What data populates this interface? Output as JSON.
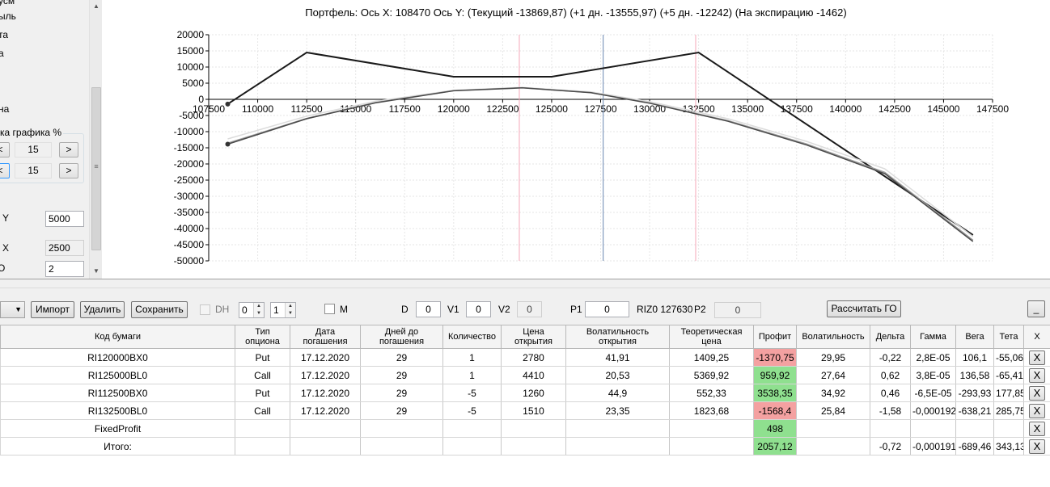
{
  "left_panel": {
    "items": [
      "усм",
      "ыль",
      "та",
      "а",
      "на"
    ],
    "group_label": "ка графика %",
    "row1": {
      "prev": "<",
      "value": "15",
      "next": ">"
    },
    "row2": {
      "prev": "<",
      "value": "15",
      "next": ">"
    },
    "y_label": "Y",
    "y_value": "5000",
    "x_label": "X",
    "x_value": "2500",
    "o_label": "O",
    "o_value": "2",
    "grip": "≡"
  },
  "chart": {
    "title": "Портфель: Ось X: 108470 Ось Y:  (Текущий -13869,87)  (+1 дн. -13555,97)  (+5 дн. -12242)  (На экспирацию -1462)"
  },
  "chart_data": {
    "type": "line",
    "title": "Портфель: Ось X: 108470 Ось Y:  (Текущий -13869,87)  (+1 дн. -13555,97)  (+5 дн. -12242)  (На экспирацию -1462)",
    "xlabel": "",
    "ylabel": "",
    "xlim": [
      107500,
      147500
    ],
    "ylim": [
      -50000,
      20000
    ],
    "x_ticks": [
      "107500",
      "110000",
      "112500",
      "115000",
      "117500",
      "120000",
      "122500",
      "125000",
      "127500",
      "130000",
      "132500",
      "135000",
      "137500",
      "140000",
      "142500",
      "145000",
      "147500"
    ],
    "y_ticks": [
      "20000",
      "15000",
      "10000",
      "5000",
      "0",
      "-5000",
      "-10000",
      "-15000",
      "-20000",
      "-25000",
      "-30000",
      "-35000",
      "-40000",
      "-45000",
      "-50000"
    ],
    "grid": true,
    "vertical_lines": [
      {
        "x": 123350,
        "color": "#f4a8b8"
      },
      {
        "x": 127630,
        "color": "#6a86b0"
      },
      {
        "x": 132350,
        "color": "#f4a8b8"
      }
    ],
    "series": [
      {
        "color": "#1a1a1a",
        "points": [
          [
            108470,
            -1462
          ],
          [
            112500,
            14500
          ],
          [
            120000,
            7000
          ],
          [
            125000,
            7000
          ],
          [
            132500,
            14500
          ],
          [
            146500,
            -42000
          ]
        ]
      },
      {
        "color": "#dcdcdc",
        "points": [
          [
            108470,
            -12242
          ],
          [
            112500,
            -5200
          ],
          [
            116000,
            -600
          ],
          [
            120000,
            2800
          ],
          [
            123500,
            3700
          ],
          [
            127000,
            2300
          ],
          [
            130000,
            -700
          ],
          [
            134000,
            -6000
          ],
          [
            138000,
            -13000
          ],
          [
            142000,
            -21500
          ],
          [
            146500,
            -42500
          ]
        ]
      },
      {
        "color": "#9e9e9e",
        "points": [
          [
            108470,
            -13556
          ],
          [
            112500,
            -5900
          ],
          [
            116000,
            -1000
          ],
          [
            120000,
            2700
          ],
          [
            123500,
            3600
          ],
          [
            127000,
            2100
          ],
          [
            130000,
            -1100
          ],
          [
            134000,
            -6600
          ],
          [
            138000,
            -13800
          ],
          [
            142000,
            -22600
          ],
          [
            146500,
            -43600
          ]
        ]
      },
      {
        "color": "#4a4a4a",
        "points": [
          [
            108470,
            -13870
          ],
          [
            112500,
            -6000
          ],
          [
            116000,
            -1100
          ],
          [
            120000,
            2650
          ],
          [
            123500,
            3550
          ],
          [
            127000,
            2050
          ],
          [
            130000,
            -1200
          ],
          [
            134000,
            -6800
          ],
          [
            138000,
            -14100
          ],
          [
            142000,
            -23000
          ],
          [
            146500,
            -44000
          ]
        ]
      }
    ],
    "markers": [
      [
        108470,
        -1462
      ],
      [
        108470,
        -13870
      ]
    ]
  },
  "toolbar": {
    "dropdown_value": "",
    "import_label": "Импорт",
    "delete_label": "Удалить",
    "save_label": "Сохранить",
    "dh_label": "DH",
    "spin1_value": "0",
    "spin2_value": "1",
    "m_label": "M",
    "d_label": "D",
    "d_value": "0",
    "v1_label": "V1",
    "v1_value": "0",
    "v2_label": "V2",
    "v2_value": "0",
    "p1_label": "P1",
    "p1_value": "0",
    "riz_label": "RIZ0 127630",
    "p2_label": "P2",
    "p2_value": "0",
    "calc_label": "Рассчитать ГО",
    "minimize_label": "_"
  },
  "grid": {
    "columns": [
      "Код бумаги",
      "Тип опциона",
      "Дата погашения",
      "Дней до погашения",
      "Количество",
      "Цена открытия",
      "Волатильность открытия",
      "Теоретическая цена",
      "Профит",
      "Волатильность",
      "Дельта",
      "Гамма",
      "Вега",
      "Тета",
      "X"
    ],
    "rows": [
      {
        "code": "RI120000BX0",
        "type": "Put",
        "date": "17.12.2020",
        "days": "29",
        "qty": "1",
        "price": "2780",
        "vol_open": "41,91",
        "theo": "1409,25",
        "profit": "-1370,75",
        "vol": "29,95",
        "delta": "-0,22",
        "gamma": "2,8E-05",
        "vega": "106,1",
        "theta": "-55,06",
        "x": "X"
      },
      {
        "code": "RI125000BL0",
        "type": "Call",
        "date": "17.12.2020",
        "days": "29",
        "qty": "1",
        "price": "4410",
        "vol_open": "20,53",
        "theo": "5369,92",
        "profit": "959,92",
        "vol": "27,64",
        "delta": "0,62",
        "gamma": "3,8E-05",
        "vega": "136,58",
        "theta": "-65,41",
        "x": "X"
      },
      {
        "code": "RI112500BX0",
        "type": "Put",
        "date": "17.12.2020",
        "days": "29",
        "qty": "-5",
        "price": "1260",
        "vol_open": "44,9",
        "theo": "552,33",
        "profit": "3538,35",
        "vol": "34,92",
        "delta": "0,46",
        "gamma": "-6,5E-05",
        "vega": "-293,93",
        "theta": "177,85",
        "x": "X"
      },
      {
        "code": "RI132500BL0",
        "type": "Call",
        "date": "17.12.2020",
        "days": "29",
        "qty": "-5",
        "price": "1510",
        "vol_open": "23,35",
        "theo": "1823,68",
        "profit": "-1568,4",
        "vol": "25,84",
        "delta": "-1,58",
        "gamma": "-0,000192",
        "vega": "-638,21",
        "theta": "285,75",
        "x": "X"
      }
    ],
    "fixed": {
      "code": "FixedProfit",
      "profit": "498",
      "x": "X"
    },
    "total": {
      "code": "Итого:",
      "profit": "2057,12",
      "delta": "-0,72",
      "gamma": "-0,000191",
      "vega": "-689,46",
      "theta": "343,13",
      "x": "X"
    }
  }
}
